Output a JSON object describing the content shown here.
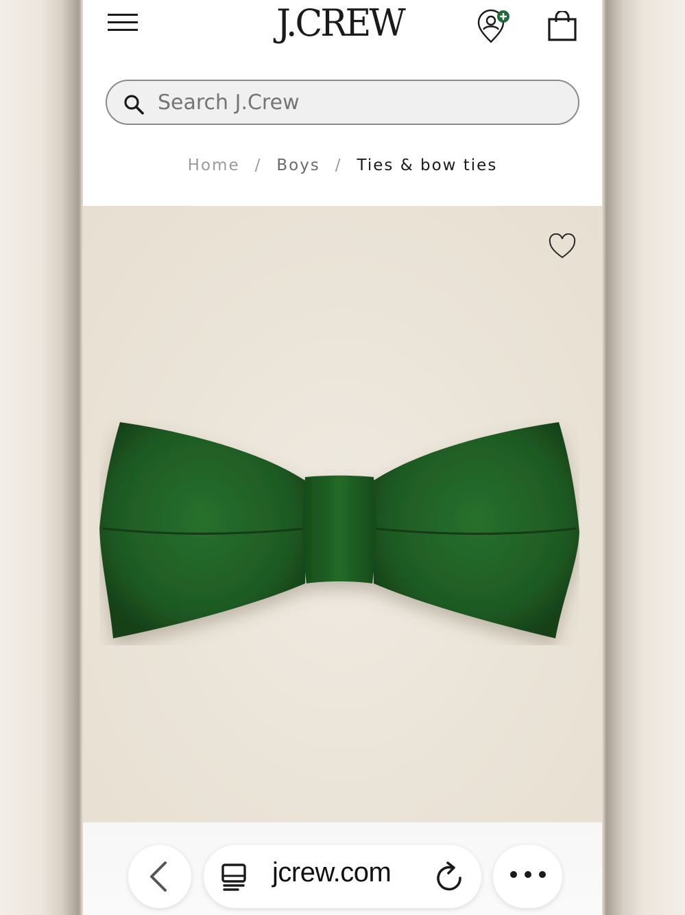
{
  "header": {
    "logo_text": "J.CREW",
    "menu_icon": "hamburger-menu-icon",
    "account_icon": "account-location-plus-icon",
    "bag_icon": "shopping-bag-icon",
    "account_badge_color": "#1d6b3a"
  },
  "search": {
    "placeholder": "Search J.Crew",
    "value": "",
    "icon": "search-icon"
  },
  "breadcrumb": {
    "items": [
      "Home",
      "Boys",
      "Ties & bow ties"
    ],
    "separator": "/"
  },
  "product": {
    "wishlist_icon": "heart-outline-icon",
    "image_subject": "green-velvet-bow-tie",
    "colors": {
      "velvet": "#1f5a24",
      "background": "#ebe4d8"
    }
  },
  "browser": {
    "url": "jcrew.com",
    "back_icon": "chevron-left-icon",
    "tabs_icon": "tabs-icon",
    "reload_icon": "reload-icon",
    "more_icon": "more-dots-icon"
  }
}
